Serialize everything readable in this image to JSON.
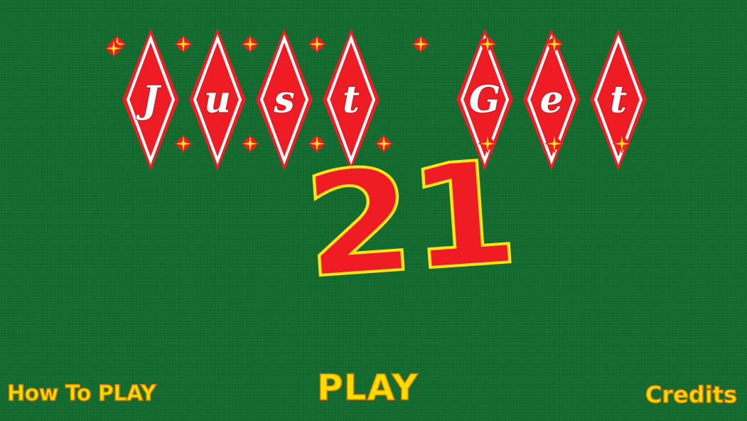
{
  "title": {
    "diamond_letters": [
      "J",
      "u",
      "s",
      "t",
      "",
      "G",
      "e",
      "t"
    ],
    "number": "21"
  },
  "menu": {
    "how_to_play_label": "How To PLAY",
    "play_label": "PLAY",
    "credits_label": "Credits"
  },
  "colors": {
    "felt": "#0f6a2b",
    "diamond_fill": "#ee1c24",
    "diamond_border": "#ffffff",
    "sparkle": "#ffe417",
    "number_fill": "#ee1c24",
    "number_outline": "#ffe417",
    "menu_text": "#ffdc00"
  },
  "icons": [
    "sparkle-icon"
  ]
}
